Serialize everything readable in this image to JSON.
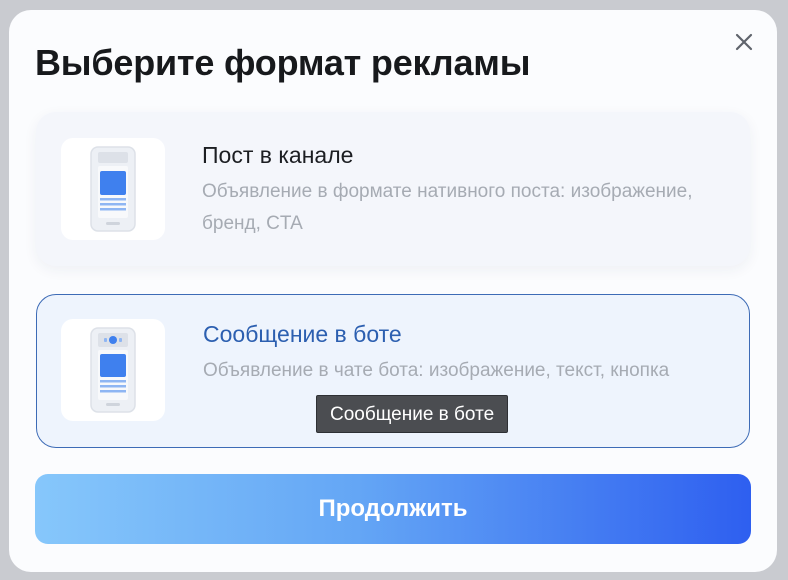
{
  "modal": {
    "title": "Выберите формат рекламы",
    "close_icon": "close-icon",
    "options": [
      {
        "title": "Пост в канале",
        "description": "Объявление в формате нативного поста: изображение, бренд, CTA",
        "icon": "phone-post-icon",
        "selected": false
      },
      {
        "title": "Сообщение в боте",
        "description": "Объявление в чате бота: изображение, текст, кнопка",
        "icon": "phone-bot-message-icon",
        "selected": true
      }
    ],
    "tooltip": "Сообщение в боте",
    "continue_label": "Продолжить"
  },
  "colors": {
    "accent": "#2c5fb0",
    "button_gradient_start": "#86c7fb",
    "button_gradient_end": "#2e5ff0"
  }
}
